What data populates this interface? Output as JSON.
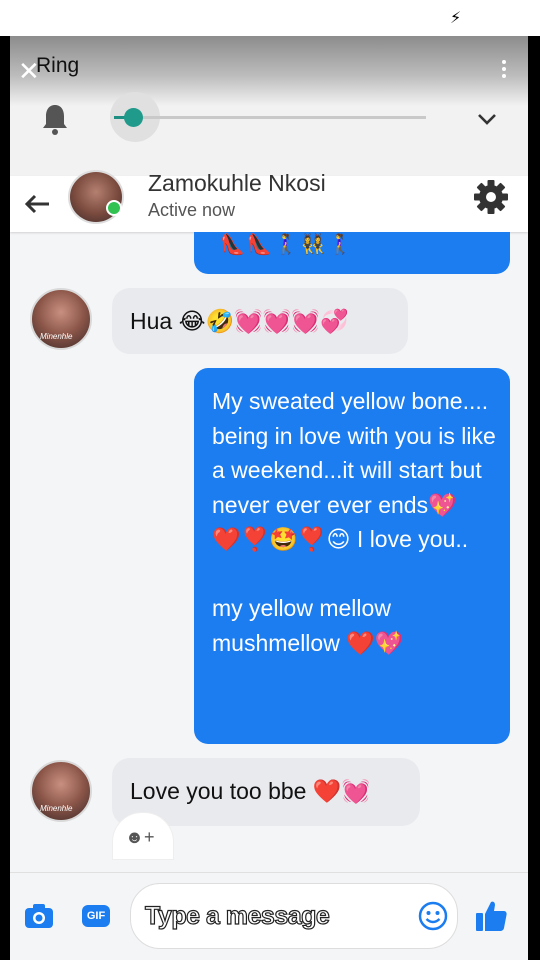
{
  "ring": {
    "title": "Ring",
    "volume_level": 0.08
  },
  "chat": {
    "contact_name": "Zamokuhle Nkosi",
    "status": "Active now"
  },
  "messages": [
    {
      "from": "me",
      "text": "👠👠🚶‍♀️👯‍♀️🚶‍♀️"
    },
    {
      "from": "contact",
      "text": "Hua 😂🤣💓💓💓💞"
    },
    {
      "from": "me",
      "text": "My sweated yellow bone.... being in love with you is like a weekend...it will start but never ever ever ends💖❤️❣️🤩❣️😊 I love you..\n\nmy yellow mellow mushmellow ❤️💖"
    },
    {
      "from": "contact",
      "text": "Love you too bbe ❤️💓"
    }
  ],
  "composer": {
    "placeholder": "Type a message",
    "gif_label": "GIF"
  },
  "avatar_tag": "Minenhle",
  "icons": [
    "close-icon",
    "more-icon",
    "bell-icon",
    "chevron-down-icon",
    "back-arrow-icon",
    "gear-icon",
    "camera-icon",
    "gif-icon",
    "smiley-icon",
    "thumbs-up-icon",
    "react-icon"
  ],
  "colors": {
    "accent": "#1b7df0",
    "online": "#31c252",
    "slider": "#1f9a8b"
  }
}
